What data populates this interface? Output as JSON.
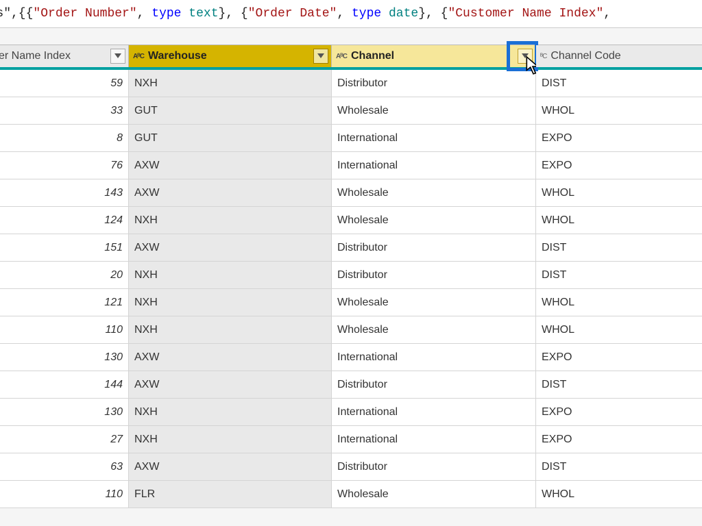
{
  "formula": {
    "pre": "ders\",{{",
    "s1": "\"Order Number\"",
    "c1": ", ",
    "kw1": "type",
    "sp1": " ",
    "ty1": "text",
    "c2": "}, {",
    "s2": "\"Order Date\"",
    "c3": ", ",
    "kw2": "type",
    "sp2": " ",
    "ty2": "date",
    "c4": "}, {",
    "s3": "\"Customer Name Index\"",
    "c5": ","
  },
  "headers": {
    "idx": "er Name Index",
    "wh": "Warehouse",
    "chan": "Channel",
    "code": "Channel Code",
    "type_abc": "AᴮC",
    "type_abc2": "ᴮC"
  },
  "rows": [
    {
      "idx": "59",
      "wh": "NXH",
      "chan": "Distributor",
      "code": "DIST"
    },
    {
      "idx": "33",
      "wh": "GUT",
      "chan": "Wholesale",
      "code": "WHOL"
    },
    {
      "idx": "8",
      "wh": "GUT",
      "chan": "International",
      "code": "EXPO"
    },
    {
      "idx": "76",
      "wh": "AXW",
      "chan": "International",
      "code": "EXPO"
    },
    {
      "idx": "143",
      "wh": "AXW",
      "chan": "Wholesale",
      "code": "WHOL"
    },
    {
      "idx": "124",
      "wh": "NXH",
      "chan": "Wholesale",
      "code": "WHOL"
    },
    {
      "idx": "151",
      "wh": "AXW",
      "chan": "Distributor",
      "code": "DIST"
    },
    {
      "idx": "20",
      "wh": "NXH",
      "chan": "Distributor",
      "code": "DIST"
    },
    {
      "idx": "121",
      "wh": "NXH",
      "chan": "Wholesale",
      "code": "WHOL"
    },
    {
      "idx": "110",
      "wh": "NXH",
      "chan": "Wholesale",
      "code": "WHOL"
    },
    {
      "idx": "130",
      "wh": "AXW",
      "chan": "International",
      "code": "EXPO"
    },
    {
      "idx": "144",
      "wh": "AXW",
      "chan": "Distributor",
      "code": "DIST"
    },
    {
      "idx": "130",
      "wh": "NXH",
      "chan": "International",
      "code": "EXPO"
    },
    {
      "idx": "27",
      "wh": "NXH",
      "chan": "International",
      "code": "EXPO"
    },
    {
      "idx": "63",
      "wh": "AXW",
      "chan": "Distributor",
      "code": "DIST"
    },
    {
      "idx": "110",
      "wh": "FLR",
      "chan": "Wholesale",
      "code": "WHOL"
    }
  ]
}
